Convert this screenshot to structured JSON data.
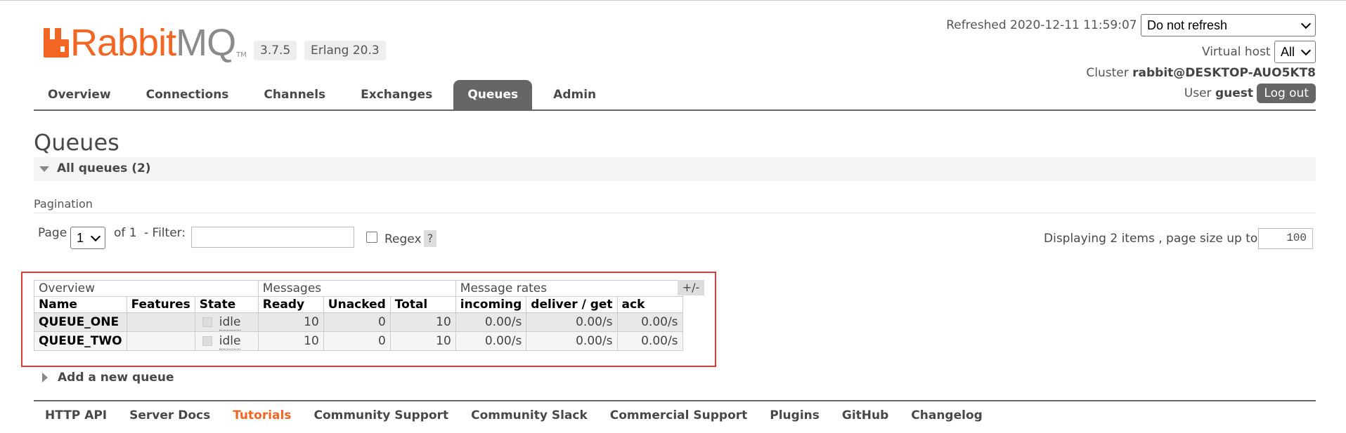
{
  "header": {
    "logo_rabbit": "Rabbit",
    "logo_mq": "MQ",
    "logo_tm": "TM",
    "version": "3.7.5",
    "erlang": "Erlang 20.3",
    "refreshed_label": "Refreshed 2020-12-11 11:59:07",
    "refresh_select": "Do not refresh",
    "vhost_label": "Virtual host",
    "vhost_select": "All",
    "cluster_label": "Cluster",
    "cluster_value": "rabbit@DESKTOP-AUO5KT8",
    "user_label": "User",
    "user_value": "guest",
    "logout_label": "Log out"
  },
  "tabs": [
    {
      "label": "Overview",
      "active": false
    },
    {
      "label": "Connections",
      "active": false
    },
    {
      "label": "Channels",
      "active": false
    },
    {
      "label": "Exchanges",
      "active": false
    },
    {
      "label": "Queues",
      "active": true
    },
    {
      "label": "Admin",
      "active": false
    }
  ],
  "page": {
    "title": "Queues",
    "section_title": "All queues (2)",
    "pagination_label": "Pagination",
    "page_label": "Page",
    "page_select": "1",
    "of_label": "of 1",
    "filter_label": "- Filter:",
    "filter_value": "",
    "regex_label": "Regex",
    "help_label": "?",
    "displaying_label": "Displaying 2 items , page size up to:",
    "page_size": "100",
    "toggle_columns": "+/-",
    "add_queue": "Add a new queue"
  },
  "table": {
    "groups": [
      "Overview",
      "Messages",
      "Message rates"
    ],
    "columns": [
      "Name",
      "Features",
      "State",
      "Ready",
      "Unacked",
      "Total",
      "incoming",
      "deliver / get",
      "ack"
    ],
    "rows": [
      {
        "name": "QUEUE_ONE",
        "features": "",
        "state": "idle",
        "ready": "10",
        "unacked": "0",
        "total": "10",
        "incoming": "0.00/s",
        "deliver_get": "0.00/s",
        "ack": "0.00/s"
      },
      {
        "name": "QUEUE_TWO",
        "features": "",
        "state": "idle",
        "ready": "10",
        "unacked": "0",
        "total": "10",
        "incoming": "0.00/s",
        "deliver_get": "0.00/s",
        "ack": "0.00/s"
      }
    ]
  },
  "footer": [
    {
      "label": "HTTP API",
      "highlight": false
    },
    {
      "label": "Server Docs",
      "highlight": false
    },
    {
      "label": "Tutorials",
      "highlight": true
    },
    {
      "label": "Community Support",
      "highlight": false
    },
    {
      "label": "Community Slack",
      "highlight": false
    },
    {
      "label": "Commercial Support",
      "highlight": false
    },
    {
      "label": "Plugins",
      "highlight": false
    },
    {
      "label": "GitHub",
      "highlight": false
    },
    {
      "label": "Changelog",
      "highlight": false
    }
  ],
  "colors": {
    "brand": "#f26522",
    "tab_active": "#666666",
    "highlight_box": "#e53935"
  }
}
